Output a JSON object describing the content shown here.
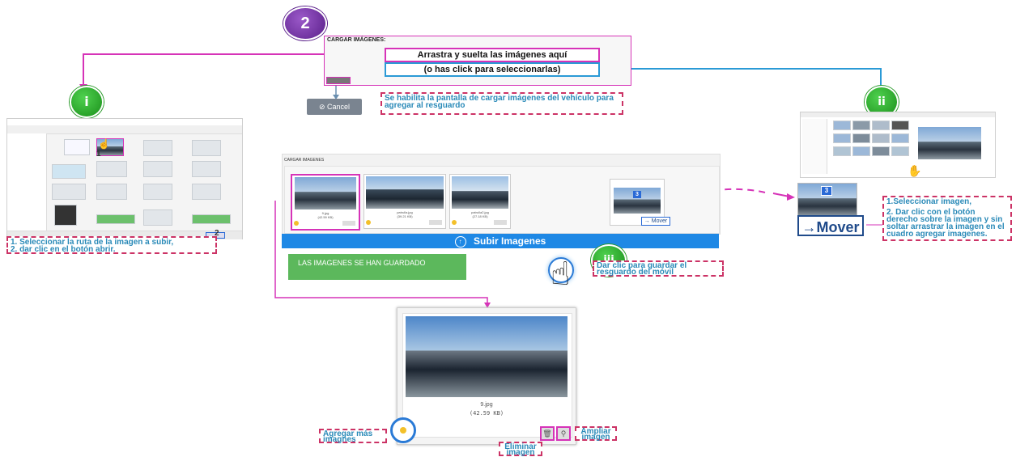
{
  "step_badge": "2",
  "top_panel": {
    "title": "CARGAR IMÁGENES:",
    "drop_text": "Arrastra y suelta las imágenes aquí",
    "click_text": "(o has click para seleccionarlas)"
  },
  "cancel_label": "Cancel",
  "callouts": {
    "enabled": "Se habilita la pantalla de cargar imágenes del vehículo para agregar al resguardo",
    "select_path_1": "1. Seleccionar la ruta de la imagen a subir,",
    "select_path_2": "2. dar clic en el botón abrir.",
    "right_1": "1.Seleccionar imagen,",
    "right_2": "2. Dar clic con el botón derecho sobre la imagen y sin soltar arrastrar la imagen en el cuadro agregar imagenes.",
    "save": "Dar clic para guardar el resguardo del móvil",
    "add_more": "Agregar más imagnes",
    "delete": "Eliminar imagen",
    "enlarge": "Ampliar imagen"
  },
  "step_labels": {
    "i": "i",
    "ii": "ii",
    "iii": "iii"
  },
  "marker_1": "1",
  "marker_2": "2",
  "mid_panel": {
    "title": "CARGAR IMAGENES",
    "thumbs": [
      {
        "name": "9.jpg",
        "size": "(42.59 KB)"
      },
      {
        "name": "patrulla.jpg",
        "size": "(39.21 KB)"
      },
      {
        "name": "patrulla2.jpg",
        "size": "(27.18 KB)"
      }
    ],
    "drag_badge": "3",
    "move_label": "→ Mover",
    "upload_label": "Subir Imagenes",
    "saved_message": "LAS IMAGENES SE HAN GUARDADO"
  },
  "mover_big": "→Mover",
  "right_badge": "3",
  "detail": {
    "filename": "9.jpg",
    "filesize": "(42.59 KB)"
  },
  "colors": {
    "magenta": "#d633b8",
    "blue_line": "#2a9ad6",
    "upload_bar": "#1e88e5",
    "saved_bg": "#5cb85c",
    "callout_border": "#cc3366",
    "callout_text": "#2a8ab8"
  }
}
